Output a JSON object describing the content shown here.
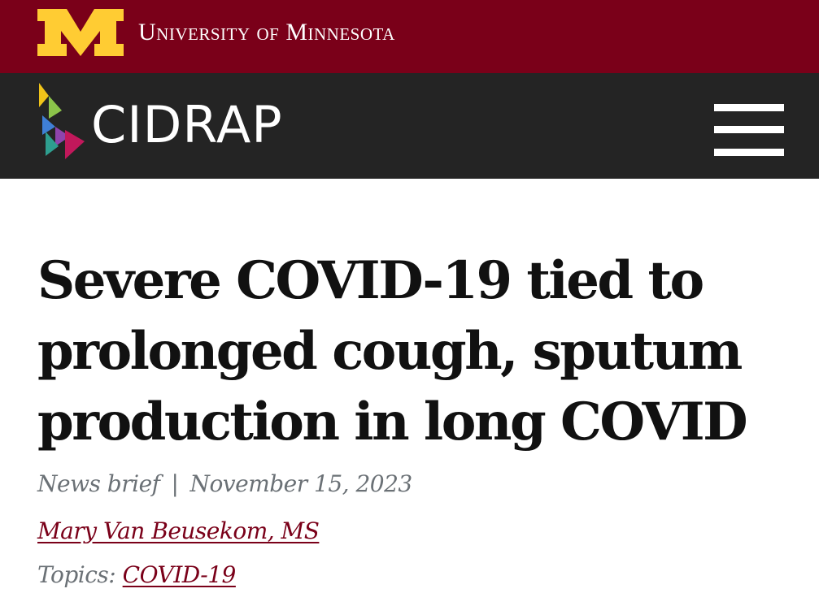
{
  "header": {
    "university_name": "University of Minnesota",
    "site_name": "CIDRAP",
    "colors": {
      "maroon": "#7a0019",
      "gold": "#ffcc33",
      "dark": "#242424"
    },
    "menu_icon": "hamburger-menu-icon"
  },
  "article": {
    "title": "Severe COVID-19 tied to prolonged cough, sputum production in long COVID",
    "type": "News brief",
    "separator": "|",
    "date": "November 15, 2023",
    "author": "Mary Van Beusekom, MS",
    "topics_label": "Topics:",
    "topic": "COVID-19"
  }
}
